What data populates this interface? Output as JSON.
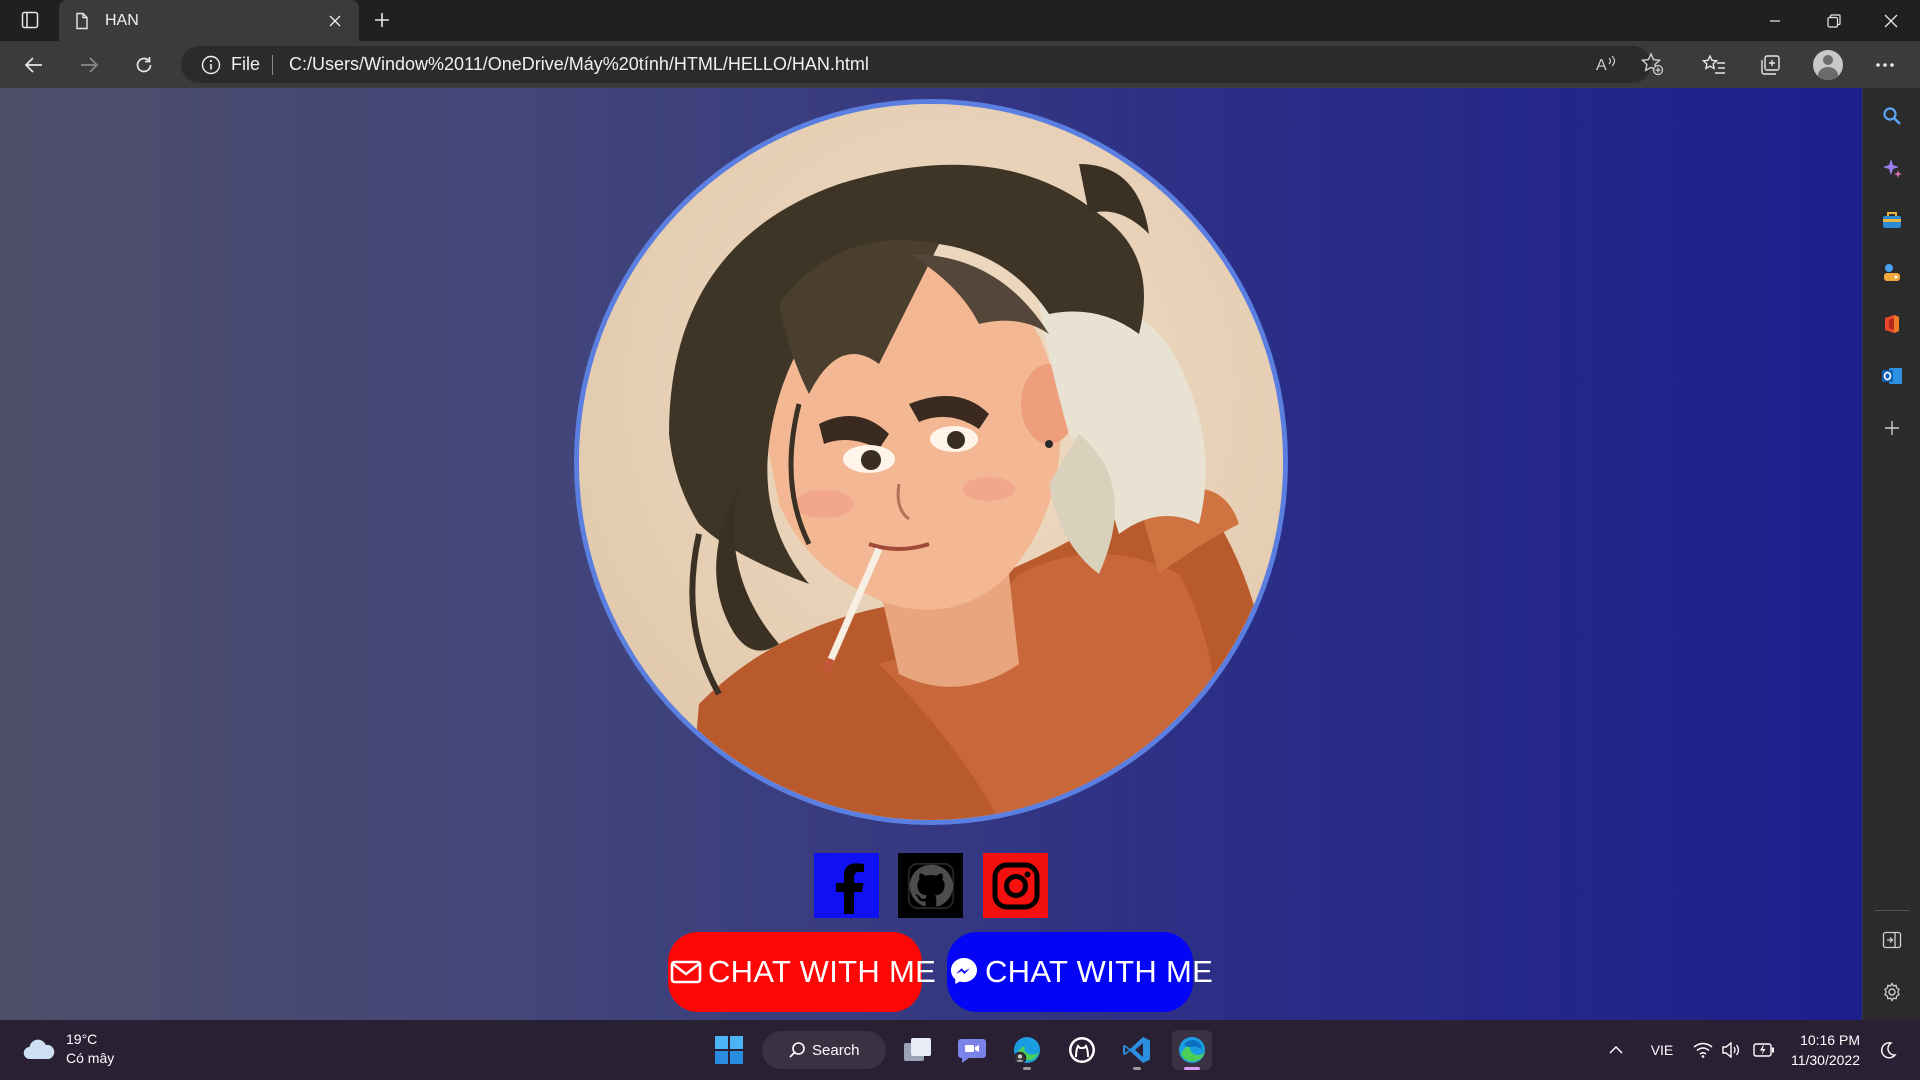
{
  "browser": {
    "tab_title": "HAN",
    "address": {
      "scheme_label": "File",
      "url": "C:/Users/Window%2011/OneDrive/Máy%20tính/HTML/HELLO/HAN.html"
    }
  },
  "page": {
    "chat_email_label": "CHAT WITH ME",
    "chat_messenger_label": "CHAT WITH ME",
    "social_icons": [
      "facebook-icon",
      "github-icon",
      "instagram-icon"
    ],
    "colors": {
      "facebook": "#1010f5",
      "github": "#000000",
      "instagram": "#f51010",
      "chat_email": "#fc0606",
      "chat_messenger": "#0505f5",
      "portrait_ring": "#5b7fe0"
    }
  },
  "taskbar": {
    "weather": {
      "temperature": "19°C",
      "condition": "Có mây"
    },
    "search_label": "Search",
    "language": "VIE",
    "clock": {
      "time": "10:16 PM",
      "date": "11/30/2022"
    }
  }
}
